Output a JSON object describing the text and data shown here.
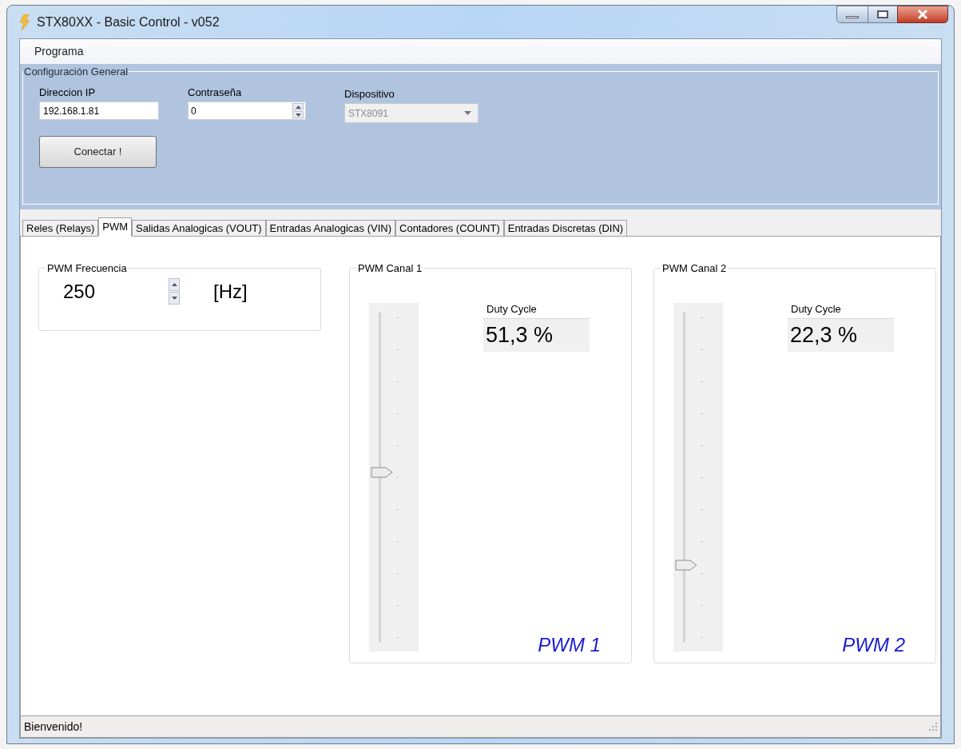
{
  "window": {
    "title": "STX80XX - Basic Control - v052"
  },
  "menu": [
    "Programa"
  ],
  "config": {
    "title": "Configuración General",
    "ip": {
      "label": "Direccion IP",
      "value": "192.168.1.81"
    },
    "password": {
      "label": "Contraseña",
      "value": "0"
    },
    "device": {
      "label": "Dispositivo",
      "value": "STX8091",
      "disabled": true
    },
    "connect_button": "Conectar !"
  },
  "tabs": [
    {
      "label": "Reles (Relays)",
      "selected": false
    },
    {
      "label": "PWM",
      "selected": true
    },
    {
      "label": "Salidas Analogicas (VOUT)",
      "selected": false
    },
    {
      "label": "Entradas Analogicas (VIN)",
      "selected": false
    },
    {
      "label": "Contadores (COUNT)",
      "selected": false
    },
    {
      "label": "Entradas Discretas (DIN)",
      "selected": false
    }
  ],
  "frequency": {
    "title": "PWM Frecuencia",
    "value": "250",
    "unit": "[Hz]"
  },
  "channels": [
    {
      "title": "PWM Canal 1",
      "duty_label": "Duty Cycle",
      "duty_value": "51,3 %",
      "level": 0.513,
      "caption": "PWM 1"
    },
    {
      "title": "PWM Canal 2",
      "duty_label": "Duty Cycle",
      "duty_value": "22,3 %",
      "level": 0.223,
      "caption": "PWM 2"
    }
  ],
  "status_bar": "Bienvenido!"
}
